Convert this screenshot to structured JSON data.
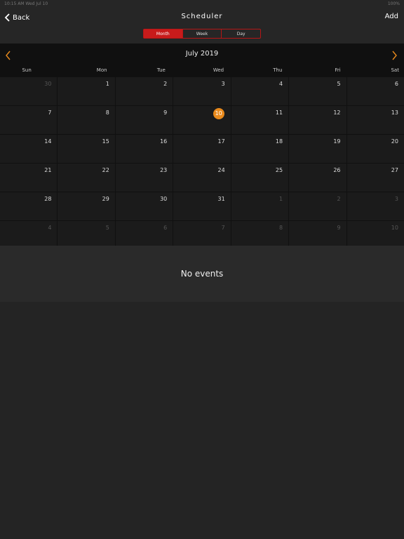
{
  "status": {
    "left": "10:15 AM   Wed Jul 10",
    "right": "100%"
  },
  "nav": {
    "back_label": "Back",
    "title": "Scheduler",
    "add_label": "Add"
  },
  "segments": [
    {
      "label": "Month",
      "active": true
    },
    {
      "label": "Week",
      "active": false
    },
    {
      "label": "Day",
      "active": false
    }
  ],
  "calendar": {
    "month_title": "July 2019",
    "weekdays": [
      "Sun",
      "Mon",
      "Tue",
      "Wed",
      "Thu",
      "Fri",
      "Sat"
    ],
    "weeks": [
      [
        {
          "d": "30",
          "m": true
        },
        {
          "d": "1"
        },
        {
          "d": "2"
        },
        {
          "d": "3"
        },
        {
          "d": "4"
        },
        {
          "d": "5"
        },
        {
          "d": "6"
        }
      ],
      [
        {
          "d": "7"
        },
        {
          "d": "8"
        },
        {
          "d": "9"
        },
        {
          "d": "10",
          "today": true
        },
        {
          "d": "11"
        },
        {
          "d": "12"
        },
        {
          "d": "13"
        }
      ],
      [
        {
          "d": "14"
        },
        {
          "d": "15"
        },
        {
          "d": "16"
        },
        {
          "d": "17"
        },
        {
          "d": "18"
        },
        {
          "d": "19"
        },
        {
          "d": "20"
        }
      ],
      [
        {
          "d": "21"
        },
        {
          "d": "22"
        },
        {
          "d": "23"
        },
        {
          "d": "24"
        },
        {
          "d": "25"
        },
        {
          "d": "26"
        },
        {
          "d": "27"
        }
      ],
      [
        {
          "d": "28"
        },
        {
          "d": "29"
        },
        {
          "d": "30"
        },
        {
          "d": "31"
        },
        {
          "d": "1",
          "m": true
        },
        {
          "d": "2",
          "m": true
        },
        {
          "d": "3",
          "m": true
        }
      ],
      [
        {
          "d": "4",
          "m": true
        },
        {
          "d": "5",
          "m": true
        },
        {
          "d": "6",
          "m": true
        },
        {
          "d": "7",
          "m": true
        },
        {
          "d": "8",
          "m": true
        },
        {
          "d": "9",
          "m": true
        },
        {
          "d": "10",
          "m": true
        }
      ]
    ]
  },
  "events": {
    "empty_text": "No events"
  },
  "colors": {
    "accent": "#c81b1b",
    "today": "#e98a1c",
    "arrow": "#e98a1c"
  }
}
